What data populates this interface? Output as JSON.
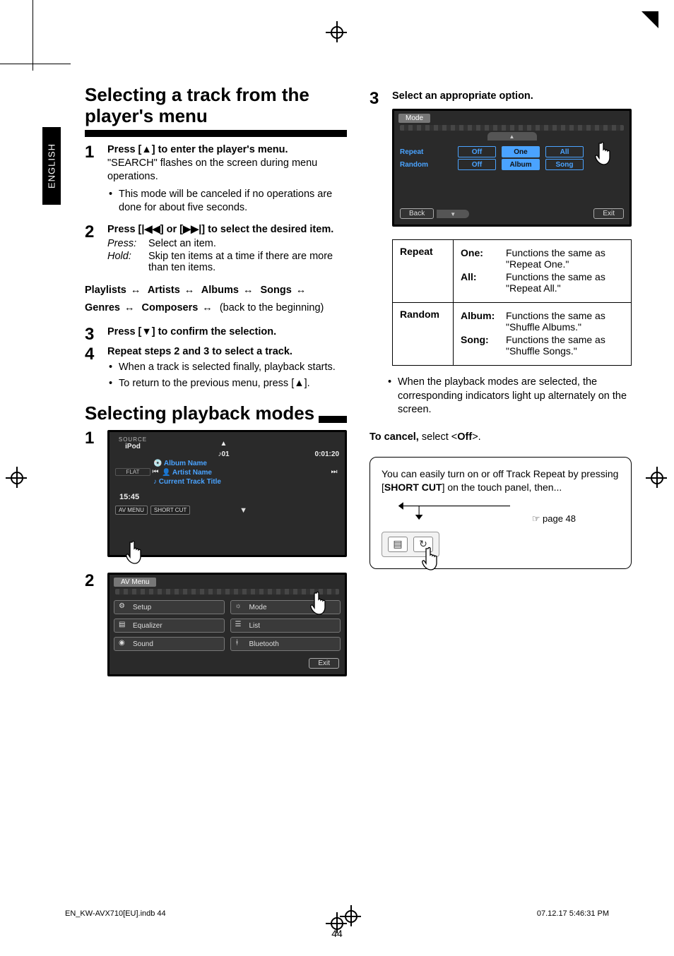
{
  "lang_tab": "ENGLISH",
  "sections": {
    "select_track_title": "Selecting a track from the player's menu",
    "select_modes_title": "Selecting playback modes"
  },
  "left": {
    "step1_title": "Press [▲] to enter the player's menu.",
    "step1_body": "\"SEARCH\" flashes on the screen during menu operations.",
    "step1_bullet": "This mode will be canceled if no operations are done for about five seconds.",
    "step2_title": "Press [|◀◀] or [▶▶|] to select the desired item.",
    "step2_press": "Select an item.",
    "step2_hold": "Skip ten items at a time if there are more than ten items.",
    "chain_items": [
      "Playlists",
      "Artists",
      "Albums",
      "Songs",
      "Genres",
      "Composers"
    ],
    "chain_tail": "(back to the beginning)",
    "step3_title": "Press [▼] to confirm the selection.",
    "step4_title": "Repeat steps 2 and 3 to select a track.",
    "step4_bullet1": "When a track is selected finally, playback starts.",
    "step4_bullet2": "To return to the previous menu, press [▲]."
  },
  "player_screen": {
    "source_label": "SOURCE",
    "source_value": "iPod",
    "eq_label": "FLAT",
    "track_num": "♪01",
    "elapsed": "0:01:20",
    "album_line": "Album Name",
    "artist_line": "Artist Name",
    "track_line": "Current Track Title",
    "clock": "15:45",
    "av_menu_btn": "AV MENU",
    "shortcut_btn": "SHORT CUT"
  },
  "av_menu_screen": {
    "title": "AV Menu",
    "items": [
      {
        "label": "Setup"
      },
      {
        "label": "Mode"
      },
      {
        "label": "Equalizer"
      },
      {
        "label": "List"
      },
      {
        "label": "Sound"
      },
      {
        "label": "Bluetooth"
      }
    ],
    "exit": "Exit"
  },
  "right": {
    "step3_title": "Select an appropriate option.",
    "mode_title": "Mode",
    "row_repeat": "Repeat",
    "row_random": "Random",
    "opts_repeat": [
      "Off",
      "One",
      "All"
    ],
    "opts_random": [
      "Off",
      "Album",
      "Song"
    ],
    "back": "Back",
    "exit": "Exit",
    "table": {
      "repeat": {
        "one": "Functions the same as \"Repeat One.\"",
        "all": "Functions the same as \"Repeat All.\""
      },
      "random": {
        "album": "Functions the same as \"Shuffle Albums.\"",
        "song": "Functions the same as \"Shuffle Songs.\""
      },
      "labels": {
        "repeat": "Repeat",
        "random": "Random",
        "one": "One",
        "all": "All",
        "album": "Album",
        "song": "Song"
      }
    },
    "note_bullet": "When the playback modes are selected, the corresponding indicators light up alternately on the screen.",
    "cancel_label": "To cancel,",
    "cancel_rest": "select <Off>.",
    "cancel_off": "Off",
    "hint_text1": "You can easily turn on or off Track Repeat by pressing [",
    "hint_shortcut": "SHORT CUT",
    "hint_text2": "] on the touch panel, then...",
    "hint_page_ref": "☞ page 48"
  },
  "page_number": "44",
  "footer": {
    "file": "EN_KW-AVX710[EU].indb   44",
    "timestamp": "07.12.17   5:46:31 PM"
  }
}
